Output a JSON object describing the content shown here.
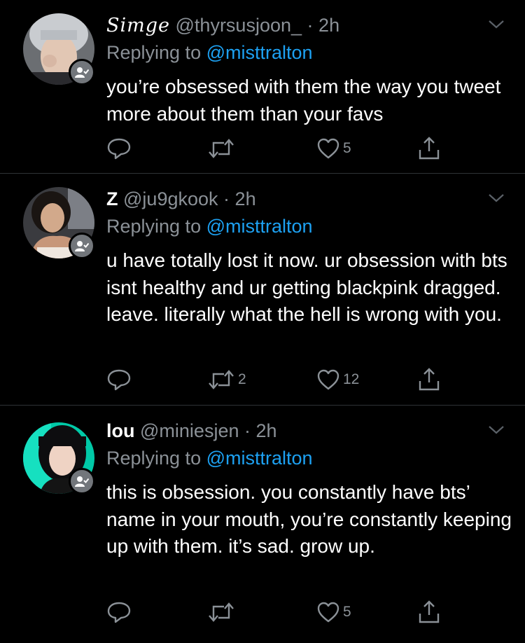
{
  "tweets": [
    {
      "name": "𝑆𝑖𝑚𝑔𝑒",
      "handle": "@thyrsusjoon_",
      "dot": "·",
      "time": "2h",
      "replying_prefix": "Replying to",
      "replying_to": "@misttralton",
      "text": "you’re obsessed with them the way you tweet more about them than your favs",
      "retweets": "",
      "likes": "5"
    },
    {
      "name": "Z",
      "handle": "@ju9gkook",
      "dot": "·",
      "time": "2h",
      "replying_prefix": "Replying to",
      "replying_to": "@misttralton",
      "text": "u have totally lost it now. ur obsession with bts isnt healthy and ur getting blackpink dragged. leave. literally what the hell is wrong with you.",
      "retweets": "2",
      "likes": "12"
    },
    {
      "name": "lou",
      "handle": "@miniesjen",
      "dot": "·",
      "time": "2h",
      "replying_prefix": "Replying to",
      "replying_to": "@misttralton",
      "text": "this is obsession. you constantly have bts’ name in your mouth, you’re constantly keeping up with them. it’s sad. grow up.",
      "retweets": "",
      "likes": "5"
    }
  ],
  "icons": {
    "reply": "reply-icon",
    "retweet": "retweet-icon",
    "like": "heart-icon",
    "share": "share-icon",
    "more": "chevron-down-icon",
    "follow": "follows-you-icon"
  },
  "colors": {
    "background": "#000000",
    "text": "#ffffff",
    "secondary": "#8b9197",
    "mention": "#1da1f2",
    "divider": "#2f3336"
  }
}
